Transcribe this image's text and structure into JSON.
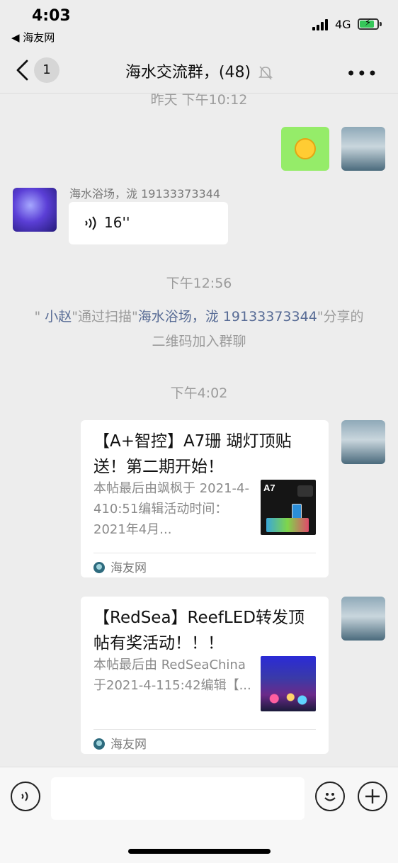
{
  "status_bar": {
    "time": "4:03",
    "back_app": "◀ 海友网",
    "network": "4G",
    "icons": [
      "signal-icon",
      "battery-charging-icon"
    ]
  },
  "nav": {
    "back_icon": "chevron-left-icon",
    "unread_count": "1",
    "title": "海水交流群，(48)",
    "mute_icon": "bell-muted-icon",
    "more_icon": "more-dots-icon"
  },
  "chat": {
    "top_timestamp": "昨天 下午10:12",
    "sticker": {
      "icon": "laughing-emoji-icon"
    },
    "voice_message": {
      "sender": "海水浴场，泷 19133373344",
      "duration": "16''",
      "icon": "voice-wave-icon"
    },
    "timestamp_2": "下午12:56",
    "system_message": {
      "quote_open": "\"",
      "inviter": "小赵",
      "text_1": "\"通过扫描\"",
      "scanned_user": "海水浴场，泷 19133373344",
      "text_2": "\"分享的二维码加入群聊"
    },
    "timestamp_3": "下午4:02",
    "cards": [
      {
        "title": "【A+智控】A7珊 瑚灯顶贴送！第二期开始！",
        "description": "本帖最后由飒枫于 2021-4-410:51编辑活动时间：2021年4月...",
        "thumb_label": "A7",
        "source": "海友网"
      },
      {
        "title": "【RedSea】ReefLED转发顶帖有奖活动！！！",
        "description": "本帖最后由 RedSeaChina于2021-4-115:42编辑【...",
        "source": "海友网"
      }
    ]
  },
  "input_bar": {
    "voice_icon": "voice-input-icon",
    "emoji_icon": "emoji-icon",
    "plus_icon": "plus-icon",
    "field_value": ""
  },
  "colors": {
    "background": "#ededed",
    "own_bubble": "#95ec69",
    "link_blue": "#576b95",
    "muted_text": "#9b9b9b"
  }
}
